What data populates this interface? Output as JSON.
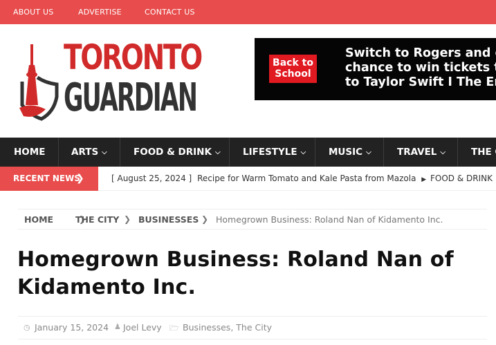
{
  "top_links": [
    "ABOUT US",
    "ADVERTISE",
    "CONTACT US"
  ],
  "logo": {
    "line1": "TORONTO",
    "line2": "GUARDIAN"
  },
  "ad": {
    "badge": "Back to School",
    "badge_line1": "Back to",
    "badge_line2": "School",
    "line1": "Switch to Rogers and g",
    "line2": "chance to win tickets t",
    "line3": "to Taylor Swift I The Er"
  },
  "nav": {
    "items": [
      {
        "label": "HOME",
        "has_dropdown": false
      },
      {
        "label": "ARTS",
        "has_dropdown": true
      },
      {
        "label": "FOOD & DRINK",
        "has_dropdown": true
      },
      {
        "label": "LIFESTYLE",
        "has_dropdown": true
      },
      {
        "label": "MUSIC",
        "has_dropdown": true
      },
      {
        "label": "TRAVEL",
        "has_dropdown": true
      },
      {
        "label": "THE C",
        "has_dropdown": false
      }
    ]
  },
  "recent_news": {
    "label": "RECENT NEWS",
    "date": "[ August 25, 2024 ]",
    "headline": "Recipe for Warm Tomato and Kale Pasta from Mazola",
    "category": "FOOD & DRINK"
  },
  "breadcrumb": {
    "items": [
      "HOME",
      "THE CITY",
      "BUSINESSES"
    ],
    "current": "Homegrown Business: Roland Nan of Kidamento Inc."
  },
  "article": {
    "title_line1": "Homegrown Business: Roland Nan of",
    "title_line2": "Kidamento Inc.",
    "date": "January 15, 2024",
    "author": "Joel Levy",
    "categories": "Businesses, The City"
  },
  "colors": {
    "accent": "#e84c4c",
    "nav_bg": "#222222",
    "logo_red": "#d12a2a",
    "logo_grey": "#333333"
  },
  "icons": {
    "nav_dropdown": "chevron-down-icon",
    "recent_arrow": "chevron-right-icon",
    "date": "clock-icon",
    "author": "user-icon",
    "category": "folder-icon"
  }
}
